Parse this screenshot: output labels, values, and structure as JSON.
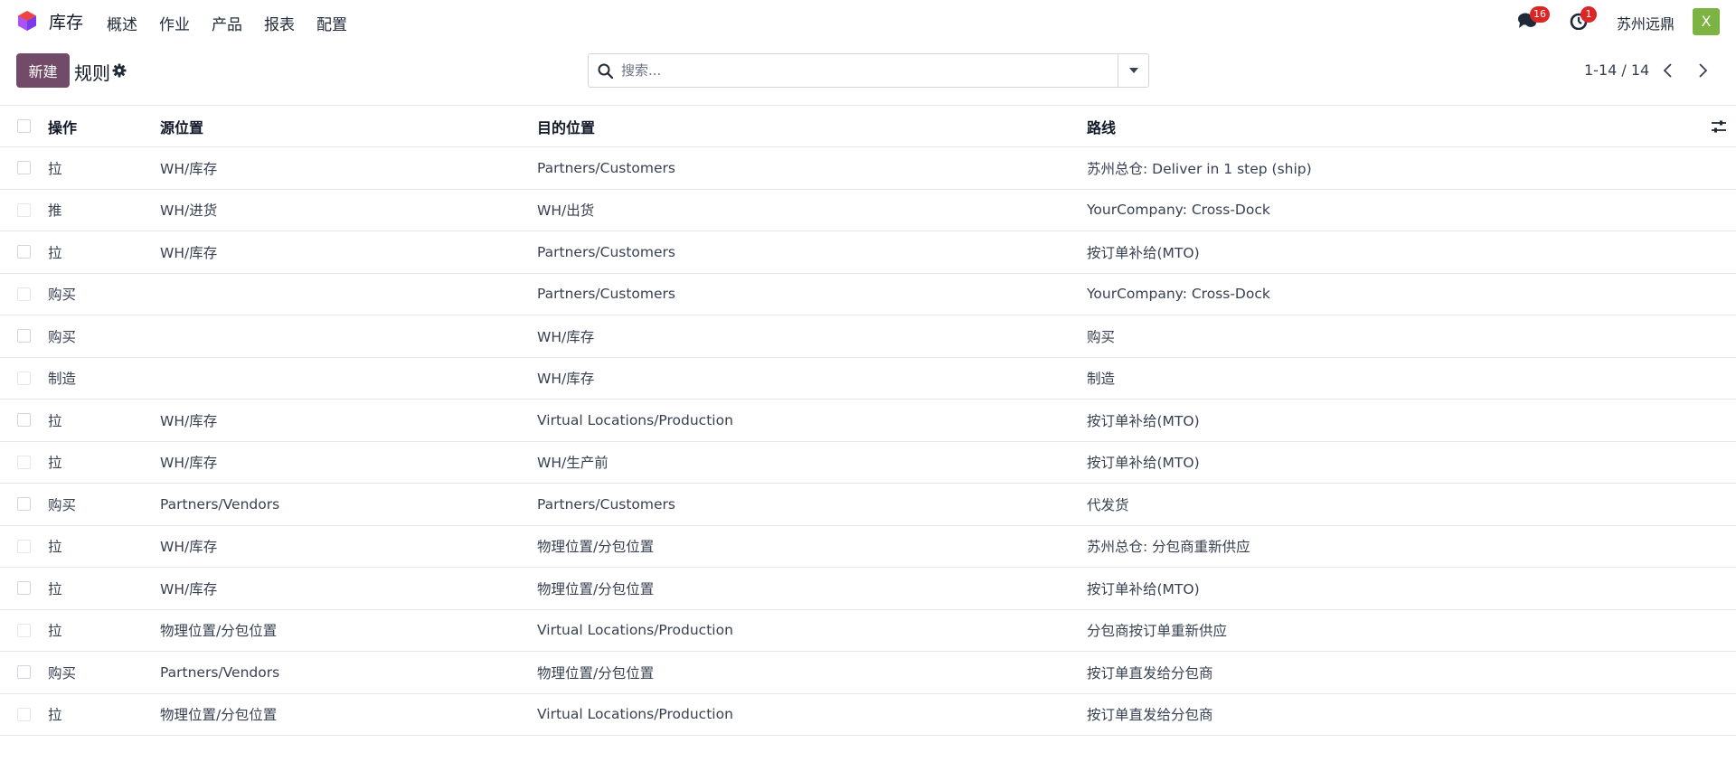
{
  "navbar": {
    "app_name": "库存",
    "menu": [
      "概述",
      "作业",
      "产品",
      "报表",
      "配置"
    ],
    "messages_count": "16",
    "activities_count": "1",
    "company": "苏州远鼎",
    "avatar_letter": "X"
  },
  "control": {
    "new_label": "新建",
    "title": "规则",
    "search_placeholder": "搜索...",
    "pager": "1-14 / 14"
  },
  "list": {
    "columns": [
      "操作",
      "源位置",
      "目的位置",
      "路线"
    ],
    "rows": [
      [
        "拉",
        "WH/库存",
        "Partners/Customers",
        "苏州总仓: Deliver in 1 step (ship)"
      ],
      [
        "推",
        "WH/进货",
        "WH/出货",
        "YourCompany: Cross-Dock"
      ],
      [
        "拉",
        "WH/库存",
        "Partners/Customers",
        "按订单补给(MTO)"
      ],
      [
        "购买",
        "",
        "Partners/Customers",
        "YourCompany: Cross-Dock"
      ],
      [
        "购买",
        "",
        "WH/库存",
        "购买"
      ],
      [
        "制造",
        "",
        "WH/库存",
        "制造"
      ],
      [
        "拉",
        "WH/库存",
        "Virtual Locations/Production",
        "按订单补给(MTO)"
      ],
      [
        "拉",
        "WH/库存",
        "WH/生产前",
        "按订单补给(MTO)"
      ],
      [
        "购买",
        "Partners/Vendors",
        "Partners/Customers",
        "代发货"
      ],
      [
        "拉",
        "WH/库存",
        "物理位置/分包位置",
        "苏州总仓: 分包商重新供应"
      ],
      [
        "拉",
        "WH/库存",
        "物理位置/分包位置",
        "按订单补给(MTO)"
      ],
      [
        "拉",
        "物理位置/分包位置",
        "Virtual Locations/Production",
        "分包商按订单重新供应"
      ],
      [
        "购买",
        "Partners/Vendors",
        "物理位置/分包位置",
        "按订单直发给分包商"
      ],
      [
        "拉",
        "物理位置/分包位置",
        "Virtual Locations/Production",
        "按订单直发给分包商"
      ]
    ]
  },
  "colors": {
    "brand": "#714b67",
    "badge": "#dc2626",
    "avatar": "#7cb342"
  }
}
